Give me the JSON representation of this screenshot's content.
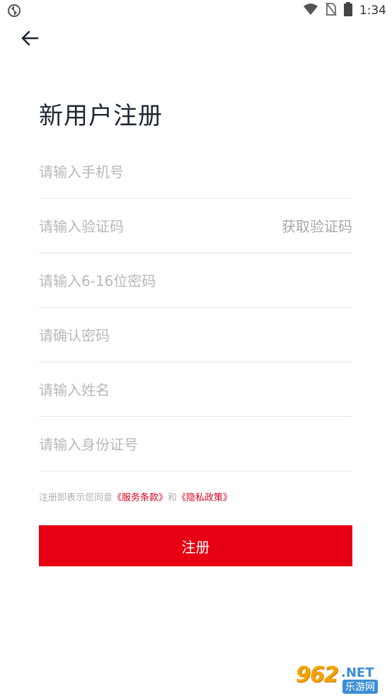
{
  "status_bar": {
    "time": "1:34",
    "icons": [
      "sync-icon",
      "wifi-icon",
      "no-sim-icon",
      "battery-icon"
    ]
  },
  "header": {
    "back_icon": "arrow-left-icon",
    "title": "新用户注册"
  },
  "form": {
    "phone_placeholder": "请输入手机号",
    "code_placeholder": "请输入验证码",
    "get_code_label": "获取验证码",
    "password_placeholder": "请输入6-16位密码",
    "confirm_password_placeholder": "请确认密码",
    "name_placeholder": "请输入姓名",
    "id_number_placeholder": "请输入身份证号"
  },
  "agreement": {
    "prefix": "注册即表示您同意",
    "terms_link": "《服务条款》",
    "conjunction": "和",
    "privacy_link": "《隐私政策》"
  },
  "register_button": {
    "label": "注册"
  },
  "watermark": {
    "number": "962",
    "net": ".NET",
    "site": "乐游网"
  },
  "colors": {
    "accent": "#e60012",
    "link": "#d9001b",
    "placeholder": "#b8b8b8",
    "divider": "#e6e6e6",
    "title": "#1f2633"
  }
}
